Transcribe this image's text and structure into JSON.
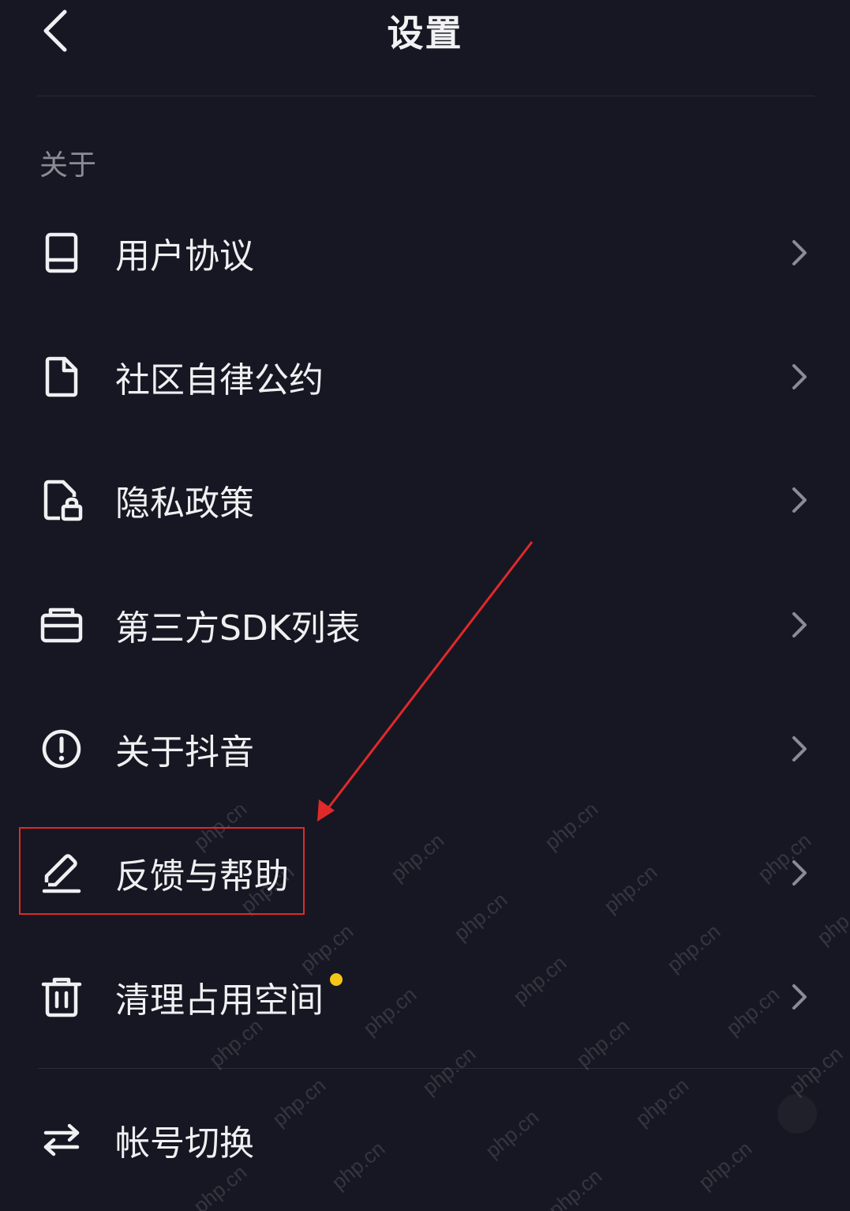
{
  "header": {
    "title": "设置",
    "back_icon": "chevron-left-icon"
  },
  "section": {
    "label": "关于"
  },
  "items": [
    {
      "label": "用户协议",
      "icon": "book-icon"
    },
    {
      "label": "社区自律公约",
      "icon": "document-icon"
    },
    {
      "label": "隐私政策",
      "icon": "privacy-lock-icon"
    },
    {
      "label": "第三方SDK列表",
      "icon": "briefcase-icon"
    },
    {
      "label": "关于抖音",
      "icon": "info-circle-icon"
    },
    {
      "label": "反馈与帮助",
      "icon": "edit-pen-icon"
    },
    {
      "label": "清理占用空间",
      "icon": "trash-icon",
      "badge": "dot"
    },
    {
      "label": "帐号切换",
      "icon": "switch-arrows-icon"
    }
  ],
  "annotation": {
    "color": "#E0292B"
  },
  "watermark": {
    "text": "php.cn"
  },
  "colors": {
    "background": "#161722",
    "text": "#F0F0F2",
    "muted": "#8A8B94",
    "badge": "#F5C518"
  }
}
